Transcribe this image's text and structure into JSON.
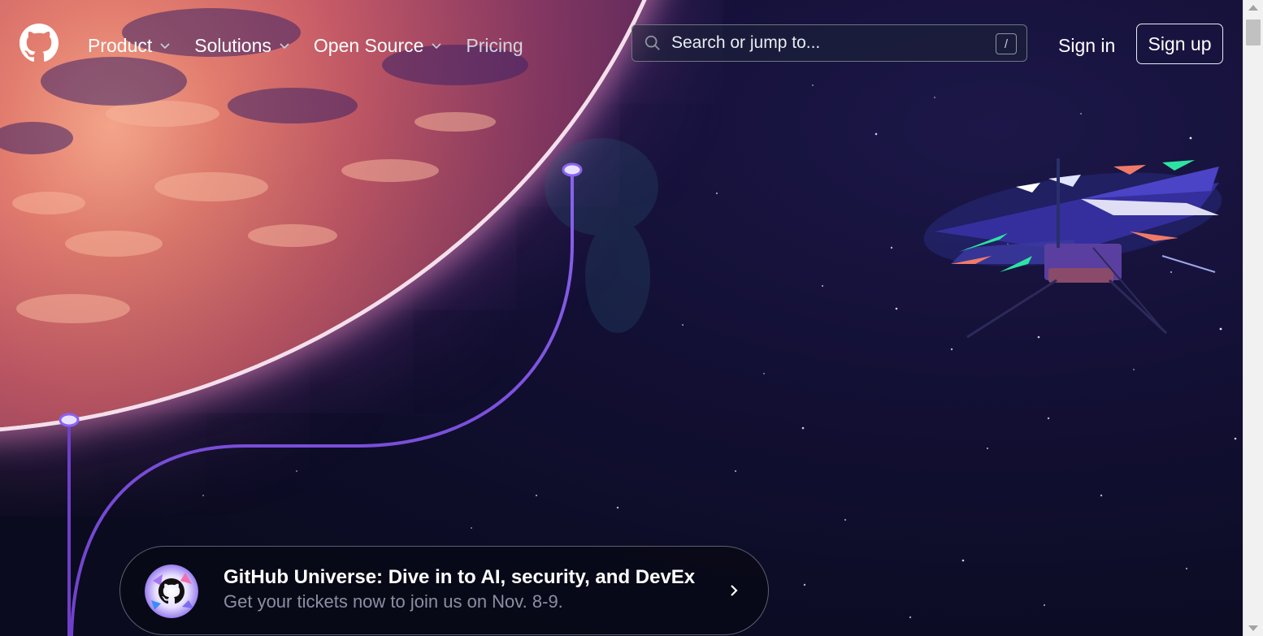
{
  "header": {
    "logo_icon": "github-mark-icon",
    "nav": {
      "product": "Product",
      "solutions": "Solutions",
      "open_source": "Open Source",
      "pricing": "Pricing"
    },
    "search": {
      "placeholder": "Search or jump to...",
      "shortcut": "/"
    },
    "sign_in": "Sign in",
    "sign_up": "Sign up"
  },
  "hero": {
    "illustration": "planet-and-helicopter-drone",
    "accent_color": "#6e40c9"
  },
  "banner": {
    "icon": "universe-octocat-icon",
    "title": "GitHub Universe: Dive in to AI, security, and DevEx",
    "subtitle": "Get your tickets now to join us on Nov. 8-9.",
    "arrow_icon": "chevron-right-icon"
  }
}
